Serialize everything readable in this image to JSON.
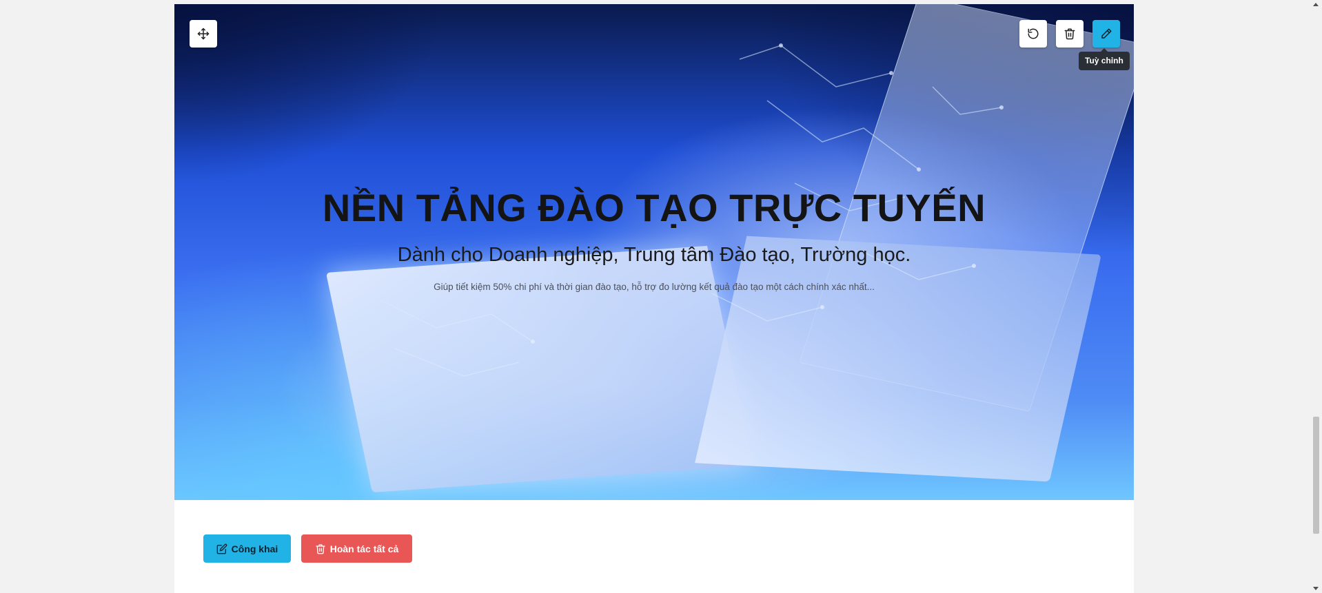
{
  "hero": {
    "title": "NỀN TẢNG ĐÀO TẠO TRỰC TUYẾN",
    "subtitle": "Dành cho Doanh nghiệp, Trung tâm Đào tạo, Trường học.",
    "description": "Giúp tiết kiệm 50% chi phí và thời gian đào tạo, hỗ trợ đo lường kết quả đào tạo một cách chính xác nhất..."
  },
  "toolbar": {
    "move_icon": "move-icon",
    "reset_icon": "rotate-ccw-icon",
    "delete_icon": "trash-icon",
    "edit_icon": "pencil-icon",
    "edit_tooltip": "Tuỳ chỉnh"
  },
  "actions": {
    "publish_label": "Công khai",
    "undo_all_label": "Hoàn tác tất cả"
  },
  "colors": {
    "primary": "#22b3e6",
    "danger": "#e95656",
    "tooltip_bg": "#2a2f36"
  }
}
